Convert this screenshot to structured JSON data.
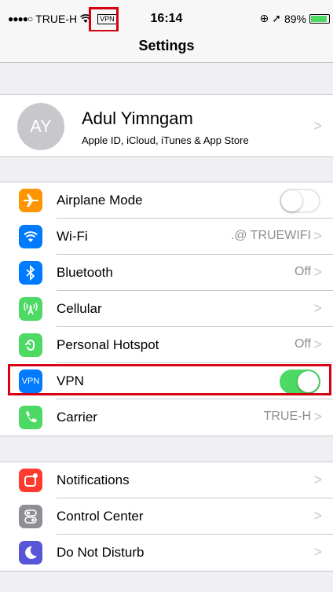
{
  "status_bar": {
    "signal_dots": "●●●●○",
    "carrier": "TRUE-H",
    "wifi_icon": "wifi-icon",
    "vpn_indicator": "VPN",
    "time": "16:14",
    "lock_icon": "⊕",
    "location_icon": "➚",
    "battery_percent": "89%",
    "battery_level": 0.89
  },
  "nav": {
    "title": "Settings"
  },
  "profile": {
    "initials": "AY",
    "name": "Adul Yimngam",
    "subtitle": "Apple ID, iCloud, iTunes & App Store"
  },
  "connectivity": [
    {
      "label": "Airplane Mode",
      "icon": "airplane-icon",
      "color": "#ff9500",
      "toggle": false
    },
    {
      "label": "Wi-Fi",
      "icon": "wifi-icon",
      "color": "#007aff",
      "value": ".@ TRUEWIFI"
    },
    {
      "label": "Bluetooth",
      "icon": "bluetooth-icon",
      "color": "#007aff",
      "value": "Off"
    },
    {
      "label": "Cellular",
      "icon": "cellular-icon",
      "color": "#4cd964"
    },
    {
      "label": "Personal Hotspot",
      "icon": "hotspot-icon",
      "color": "#4cd964",
      "value": "Off"
    },
    {
      "label": "VPN",
      "icon": "vpn-icon",
      "icon_text": "VPN",
      "color": "#007aff",
      "toggle": true
    },
    {
      "label": "Carrier",
      "icon": "phone-icon",
      "color": "#4cd964",
      "value": "TRUE-H"
    }
  ],
  "system": [
    {
      "label": "Notifications",
      "icon": "notifications-icon",
      "color": "#ff3b30"
    },
    {
      "label": "Control Center",
      "icon": "control-center-icon",
      "color": "#8e8e93"
    },
    {
      "label": "Do Not Disturb",
      "icon": "moon-icon",
      "color": "#5856d6"
    }
  ],
  "chevron": ">"
}
